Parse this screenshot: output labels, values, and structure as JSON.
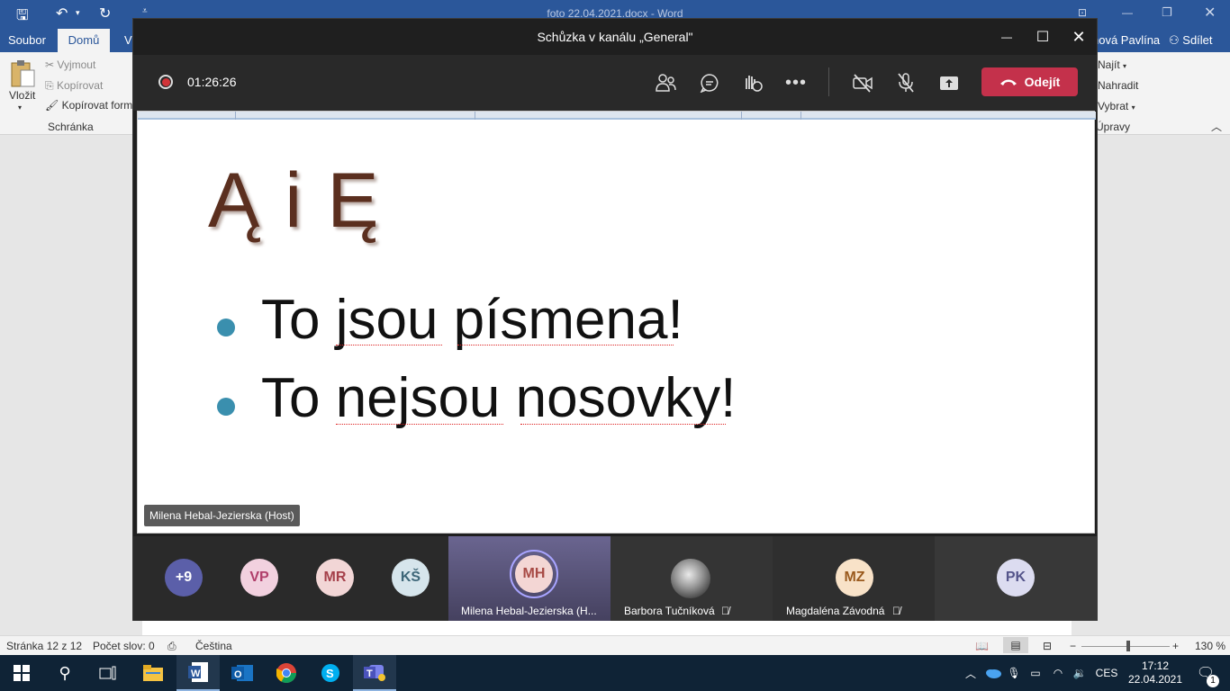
{
  "word": {
    "title": "foto 22.04.2021.docx - Word",
    "tabs": {
      "file": "Soubor",
      "home": "Domů",
      "view_partial": "V"
    },
    "user": "nová Pavlína",
    "share": "Sdílet",
    "clipboard": {
      "paste": "Vložit",
      "cut": "Vyjmout",
      "copy": "Kopírovat",
      "format_painter": "Kopírovat form",
      "group": "Schránka"
    },
    "editing": {
      "find": "Najít",
      "replace": "Nahradit",
      "select": "Vybrat",
      "group": "Úpravy"
    },
    "status": {
      "page": "Stránka 12 z 12",
      "words": "Počet slov: 0",
      "language": "Čeština",
      "zoom": "130 %"
    }
  },
  "teams": {
    "window_title": "Schůzka v kanálu „General\"",
    "timer": "01:26:26",
    "leave_label": "Odejít",
    "slide": {
      "title": "Ą i Ę",
      "bullets": [
        "To jsou písmena!",
        "To nejsou nosovky!"
      ]
    },
    "presenter_tag": "Milena Hebal-Jezierska (Host)",
    "participants": [
      {
        "initials": "+9",
        "bg": "#5b5fa9",
        "fg": "#ffffff"
      },
      {
        "initials": "VP",
        "bg": "#f2d1df",
        "fg": "#b03e6a"
      },
      {
        "initials": "MR",
        "bg": "#f2d6d6",
        "fg": "#a5404a"
      },
      {
        "initials": "KŠ",
        "bg": "#d6e5ec",
        "fg": "#3d6678"
      },
      {
        "initials": "MH",
        "bg": "#f3d6d4",
        "fg": "#a74a45",
        "name": "Milena Hebal-Jezierska (H..."
      },
      {
        "initials": "",
        "name": "Barbora Tučníková"
      },
      {
        "initials": "MZ",
        "bg": "#f8e2c8",
        "fg": "#9a5a1e",
        "name": "Magdaléna Závodná"
      },
      {
        "initials": "PK",
        "bg": "#dcdcf0",
        "fg": "#54548a"
      }
    ]
  },
  "taskbar": {
    "lang": "CES",
    "time": "17:12",
    "date": "22.04.2021",
    "notifications": "1"
  }
}
